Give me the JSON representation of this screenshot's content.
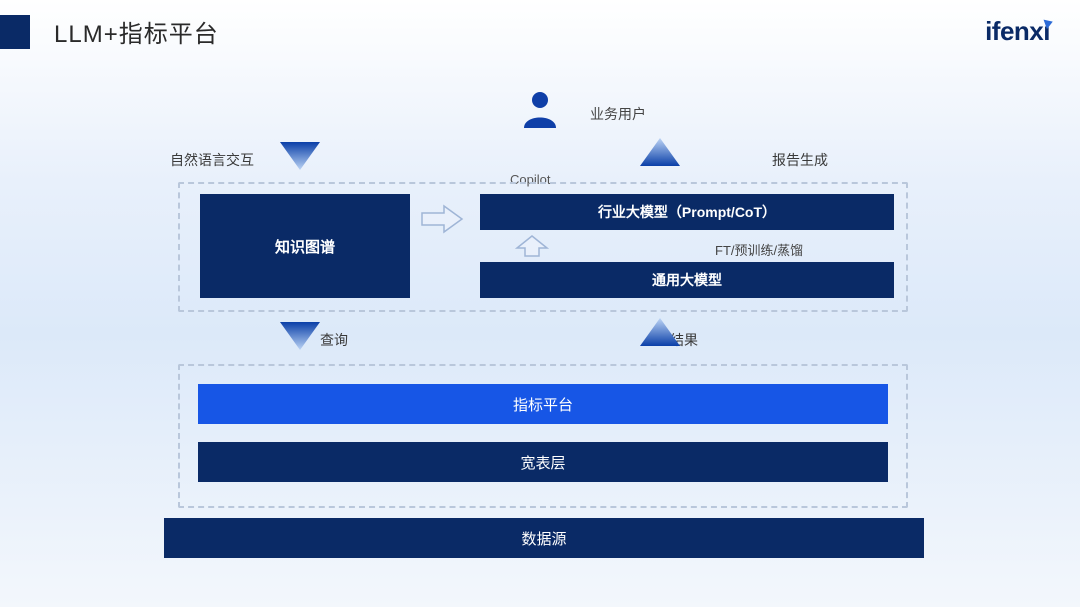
{
  "header": {
    "title": "LLM+指标平台",
    "logo": "ifenxi"
  },
  "user": {
    "label": "业务用户"
  },
  "flows": {
    "nli": "自然语言交互",
    "report": "报告生成",
    "copilot": "Copilot",
    "ft": "FT/预训练/蒸馏",
    "query": "查询",
    "result": "结果"
  },
  "boxes": {
    "kg": "知识图谱",
    "industry": "行业大模型（Prompt/CoT）",
    "general": "通用大模型",
    "metric": "指标平台",
    "wide": "宽表层",
    "source": "数据源"
  }
}
